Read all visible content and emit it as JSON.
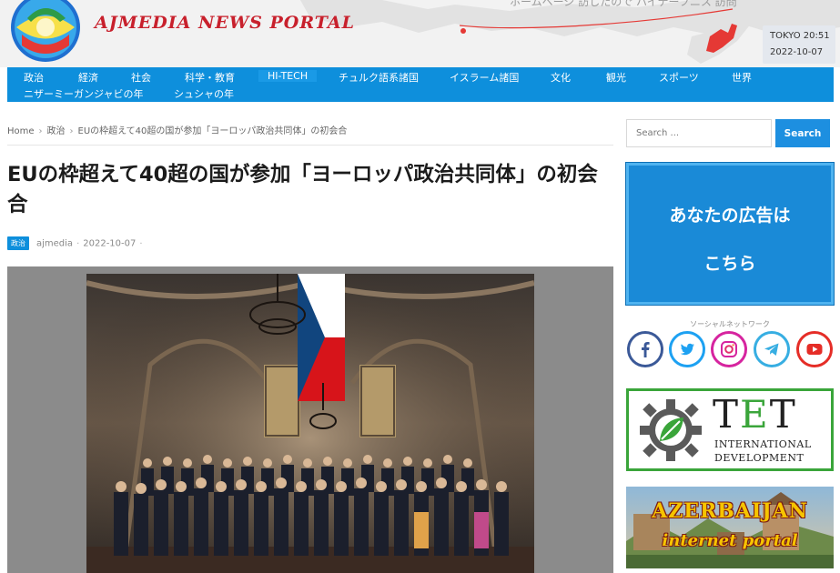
{
  "header": {
    "site_name": "AJMEDIA NEWS PORTAL",
    "tagline_partial": "ホームページ 訪したので ハイテーフニス 訪問",
    "clock_city_time": "TOKYO 20:51",
    "clock_date": "2022-10-07"
  },
  "nav": {
    "items": [
      "政治",
      "経済",
      "社会",
      "科学・教育",
      "HI-TECH",
      "チュルク語系諸国",
      "イスラーム諸国",
      "文化",
      "観光",
      "スポーツ",
      "世界",
      "ニザーミーガンジャビの年",
      "シュシャの年"
    ],
    "active": "HI-TECH"
  },
  "breadcrumb": {
    "home": "Home",
    "category": "政治",
    "current": "EUの枠超えて40超の国が参加「ヨーロッパ政治共同体」の初会合"
  },
  "article": {
    "title": "EUの枠超えて40超の国が参加「ヨーロッパ政治共同体」の初会合",
    "category": "政治",
    "author": "ajmedia",
    "date": "2022-10-07",
    "separator": "·"
  },
  "sidebar": {
    "search_placeholder": "Search ...",
    "search_button": "Search",
    "ad_line1": "あなたの広告は",
    "ad_line2": "こちら",
    "social_title": "ソーシャルネットワーク",
    "social": [
      {
        "name": "facebook",
        "icon": "facebook-icon",
        "color": "#3b5998"
      },
      {
        "name": "twitter",
        "icon": "twitter-icon",
        "color": "#1da1f2"
      },
      {
        "name": "instagram",
        "icon": "instagram-icon",
        "color": "#d6249f"
      },
      {
        "name": "telegram",
        "icon": "telegram-icon",
        "color": "#37aee2"
      },
      {
        "name": "youtube",
        "icon": "youtube-icon",
        "color": "#e52d27"
      }
    ],
    "tet_letters": "TET",
    "tet_line1": "INTERNATIONAL",
    "tet_line2": "DEVELOPMENT",
    "az_title": "AZERBAIJAN",
    "az_subtitle": "internet portal"
  },
  "colors": {
    "nav_blue": "#0e8fdc",
    "brand_red": "#c8202c",
    "tet_green": "#3aa53a"
  }
}
